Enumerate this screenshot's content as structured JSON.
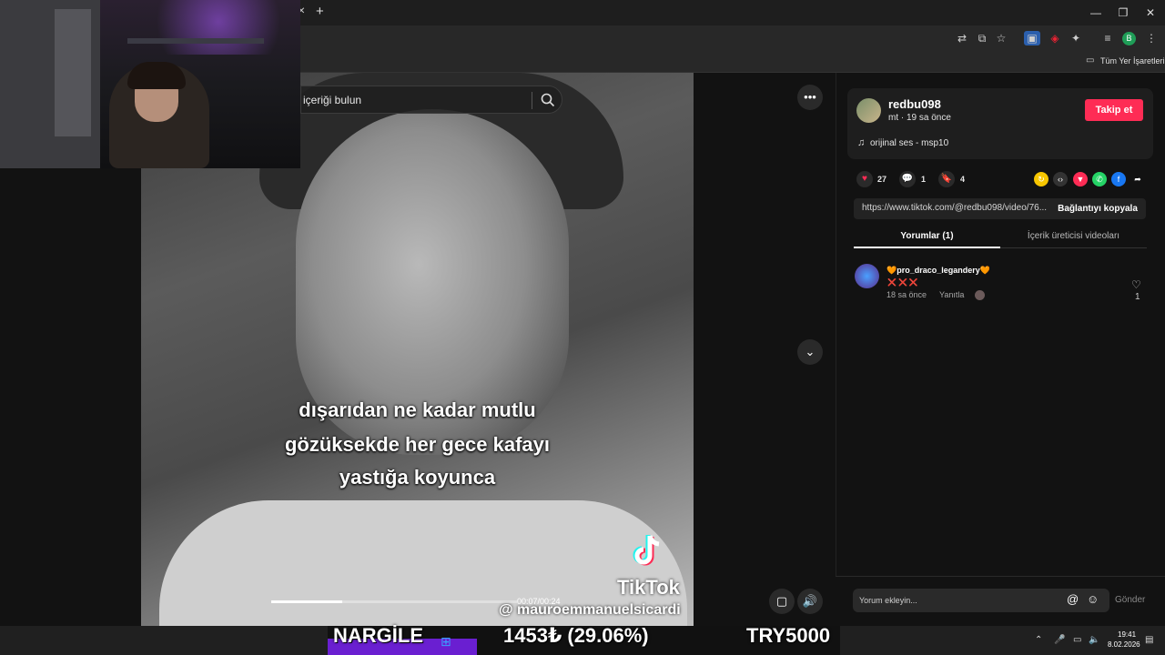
{
  "browser": {
    "bookmarks_folder": "Tüm Yer İşaretleri",
    "profile_initial": "B"
  },
  "search": {
    "placeholder": "içeriği bulun"
  },
  "video": {
    "caption_lines": [
      "dışarıdan ne kadar mutlu",
      "gözüksekde her gece kafayı",
      "yastığa koyunca"
    ],
    "watermark_brand": "TikTok",
    "watermark_user": "@ mauroemmanuelsicardi",
    "time": "00:07/00:24",
    "progress_fraction": 0.29
  },
  "author": {
    "name": "redbu098",
    "meta": "mt · 19 sa önce",
    "follow_label": "Takip et",
    "music": "orijinal ses - msp10"
  },
  "stats": {
    "likes": "27",
    "comments": "1",
    "saves": "4"
  },
  "link": {
    "url": "https://www.tiktok.com/@redbu098/video/76...",
    "copy_label": "Bağlantıyı kopyala"
  },
  "tabs": {
    "comments": "Yorumlar (1)",
    "creator": "İçerik üreticisi videoları"
  },
  "comment": {
    "user": "🧡pro_draco_legandery🧡",
    "text": "❌❌❌",
    "time": "18 sa önce",
    "reply": "Yanıtla",
    "likes": "1"
  },
  "comment_input": {
    "placeholder": "Yorum ekleyin...",
    "send": "Gönder"
  },
  "ticker": {
    "left": "NARGİLE",
    "price": "1453₺ (29.06%)",
    "right": "TRY5000"
  },
  "clock": {
    "time": "19:41",
    "date": "8.02.2026"
  },
  "colors": {
    "accent": "#fe2c55",
    "ticker_purple": "#6a1fd1"
  }
}
